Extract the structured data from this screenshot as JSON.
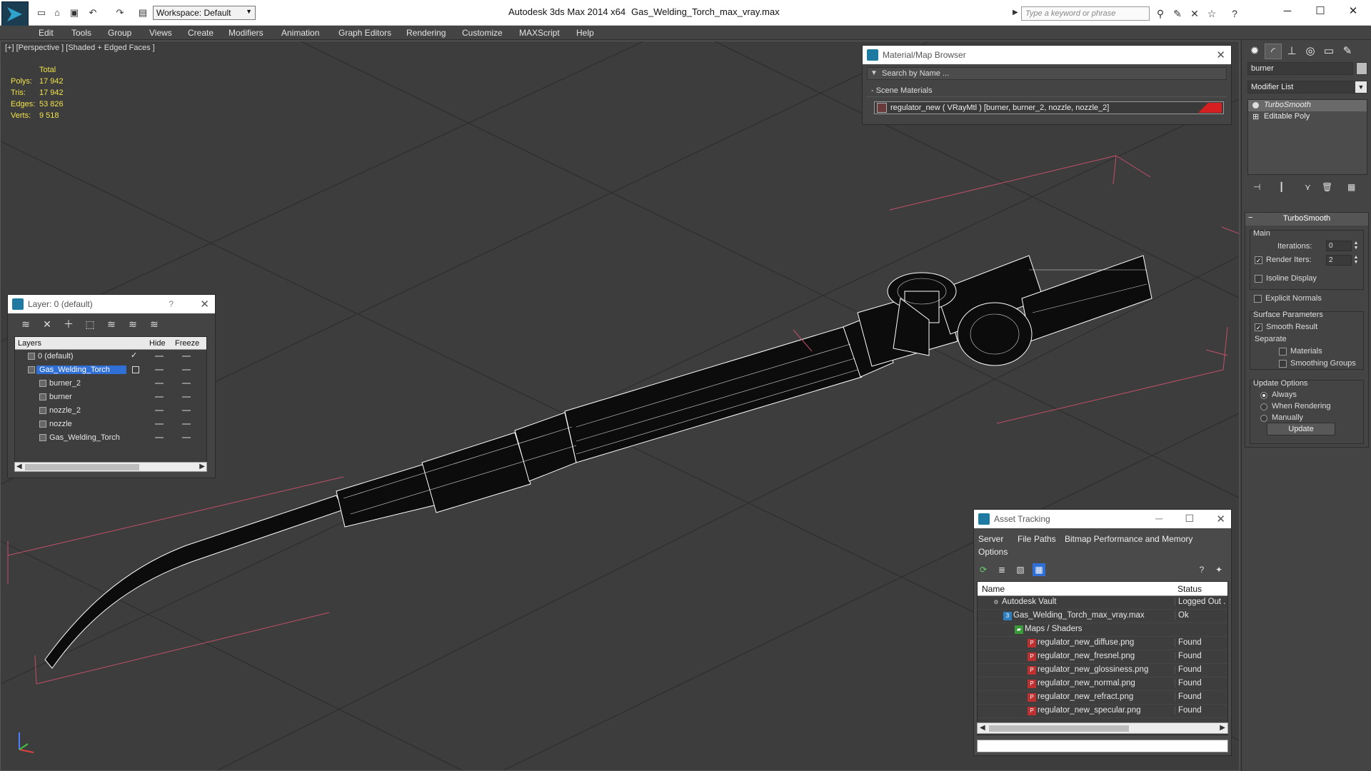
{
  "titlebar": {
    "workspace": "Workspace: Default",
    "app_title": "Autodesk 3ds Max  2014 x64",
    "file_title": "Gas_Welding_Torch_max_vray.max",
    "search_placeholder": "Type a keyword or phrase"
  },
  "menu": [
    "Edit",
    "Tools",
    "Group",
    "Views",
    "Create",
    "Modifiers",
    "Animation",
    "Graph Editors",
    "Rendering",
    "Customize",
    "MAXScript",
    "Help"
  ],
  "viewport": {
    "label": "[+] [Perspective ] [Shaded + Edged Faces ]",
    "stats_header": "Total",
    "stats": [
      {
        "label": "Polys:",
        "value": "17 942"
      },
      {
        "label": "Tris:",
        "value": "17 942"
      },
      {
        "label": "Edges:",
        "value": "53 826"
      },
      {
        "label": "Verts:",
        "value": "9 518"
      }
    ]
  },
  "layer_panel": {
    "title": "Layer: 0 (default)",
    "help": "?",
    "col_layers": "Layers",
    "col_hide": "Hide",
    "col_freeze": "Freeze",
    "rows": [
      {
        "name": "0 (default)"
      },
      {
        "name": "Gas_Welding_Torch"
      },
      {
        "name": "burner_2"
      },
      {
        "name": "burner"
      },
      {
        "name": "nozzle_2"
      },
      {
        "name": "nozzle"
      },
      {
        "name": "Gas_Welding_Torch"
      }
    ]
  },
  "material_browser": {
    "title": "Material/Map Browser",
    "search": "Search by Name ...",
    "section": "- Scene Materials",
    "item": "regulator_new  ( VRayMtl )  [burner, burner_2, nozzle, nozzle_2]"
  },
  "command_panel": {
    "object_name": "burner",
    "modifier_list": "Modifier List",
    "stack": [
      "TurboSmooth",
      "Editable Poly"
    ],
    "rollout_title": "TurboSmooth",
    "main_label": "Main",
    "iterations_label": "Iterations:",
    "iterations_value": "0",
    "render_iters_label": "Render Iters:",
    "render_iters_value": "2",
    "isoline": "Isoline Display",
    "explicit_normals": "Explicit Normals",
    "surface_params": "Surface Parameters",
    "smooth_result": "Smooth Result",
    "separate": "Separate",
    "materials": "Materials",
    "smoothing_groups": "Smoothing Groups",
    "update_options": "Update Options",
    "always": "Always",
    "when_rendering": "When Rendering",
    "manually": "Manually",
    "update_button": "Update"
  },
  "asset_tracking": {
    "title": "Asset Tracking",
    "menu": [
      "Server",
      "File",
      "Paths",
      "Bitmap Performance and Memory",
      "Options"
    ],
    "col_name": "Name",
    "col_status": "Status",
    "rows": [
      {
        "name": "Autodesk Vault",
        "status": "Logged Out ."
      },
      {
        "name": "Gas_Welding_Torch_max_vray.max",
        "status": "Ok"
      },
      {
        "name": "Maps / Shaders",
        "status": ""
      },
      {
        "name": "regulator_new_diffuse.png",
        "status": "Found"
      },
      {
        "name": "regulator_new_fresnel.png",
        "status": "Found"
      },
      {
        "name": "regulator_new_glossiness.png",
        "status": "Found"
      },
      {
        "name": "regulator_new_normal.png",
        "status": "Found"
      },
      {
        "name": "regulator_new_refract.png",
        "status": "Found"
      },
      {
        "name": "regulator_new_specular.png",
        "status": "Found"
      }
    ]
  },
  "colors": {
    "selection": "#2f6fd6",
    "stats": "#f0e24a",
    "viewport": "#3d3d3d"
  }
}
